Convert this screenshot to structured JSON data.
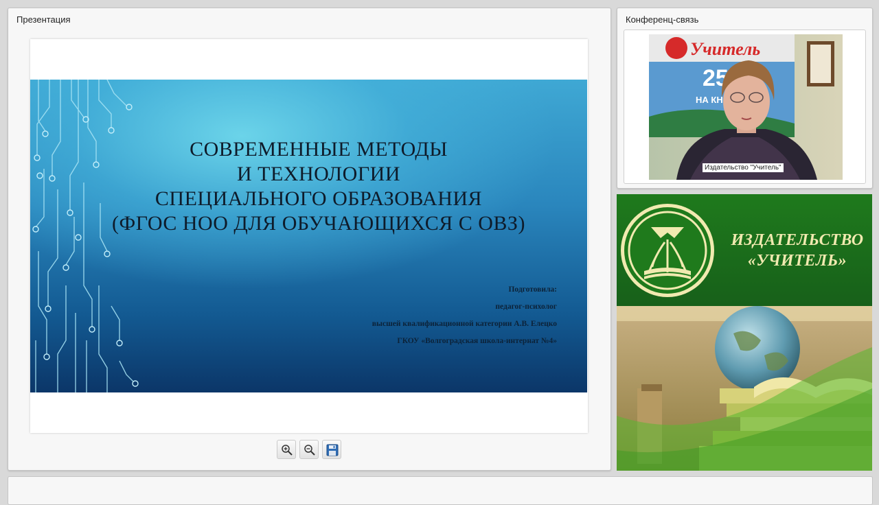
{
  "presentation": {
    "title": "Презентация",
    "slide": {
      "title_lines": [
        "СОВРЕМЕННЫЕ МЕТОДЫ",
        "И ТЕХНОЛОГИИ",
        "СПЕЦИАЛЬНОГО ОБРАЗОВАНИЯ",
        "(ФГОС НОО ДЛЯ ОБУЧАЮЩИХСЯ С ОВЗ)"
      ],
      "credit_lines": [
        "Подготовила:",
        "педагог-психолог",
        "высшей квалификационной категории А.В. Елецко",
        "ГКОУ «Волгоградская школа-интернат №4»"
      ]
    },
    "toolbar": {
      "zoom_in_icon": "zoom-in-icon",
      "zoom_out_icon": "zoom-out-icon",
      "save_icon": "floppy-disk-icon"
    }
  },
  "conference": {
    "title": "Конференц-связь",
    "video": {
      "participant_name": "Издательство \"Учитель\"",
      "background_sign_text": "Учитель",
      "background_number": "25",
      "background_caption": "НА КНИЖ"
    }
  },
  "banner": {
    "brand_line1": "ИЗДАТЕЛЬСТВО",
    "brand_line2": "«УЧИТЕЛЬ»"
  },
  "colors": {
    "slide_dark": "#0b3668",
    "slide_light": "#6fd7eb",
    "banner_green": "#1f7a1c",
    "brand_text": "#f1eab0"
  }
}
